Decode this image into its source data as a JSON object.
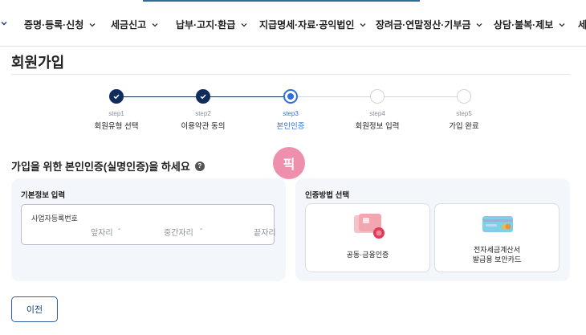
{
  "nav": {
    "items": [
      {
        "label": "증명·등록·신청"
      },
      {
        "label": "세금신고"
      },
      {
        "label": "납부·고지·환급"
      },
      {
        "label": "지급명세·자료·공익법인"
      },
      {
        "label": "장려금·연말정산·기부금"
      },
      {
        "label": "상담·불복·제보"
      },
      {
        "label": "세"
      }
    ]
  },
  "page": {
    "title": "회원가입"
  },
  "steps": [
    {
      "num": "step1",
      "name": "회원유형 선택",
      "state": "done"
    },
    {
      "num": "step2",
      "name": "이용약관 동의",
      "state": "done"
    },
    {
      "num": "step3",
      "name": "본인인증",
      "state": "current"
    },
    {
      "num": "step4",
      "name": "회원정보 입력",
      "state": "todo"
    },
    {
      "num": "step5",
      "name": "가입 완료",
      "state": "todo"
    }
  ],
  "badge": {
    "text": "픽"
  },
  "section": {
    "heading": "가입을 위한 본인인증(실명인증)을 하세요",
    "help": "?"
  },
  "basic_info": {
    "title": "기본정보 입력",
    "field_label": "사업자등록번호",
    "front": "앞자리",
    "middle": "중간자리",
    "last": "끝자리",
    "sep": "-"
  },
  "auth": {
    "title": "인증방법 선택",
    "options": [
      {
        "label": "공동·금융인증"
      },
      {
        "label_line1": "전자세금계산서",
        "label_line2": "발급용 보안카드"
      }
    ]
  },
  "buttons": {
    "prev": "이전"
  },
  "colors": {
    "navy": "#0f2c5c",
    "accent": "#2f6fd8",
    "badge": "#ef8fae",
    "panel": "#f3f6fa"
  }
}
